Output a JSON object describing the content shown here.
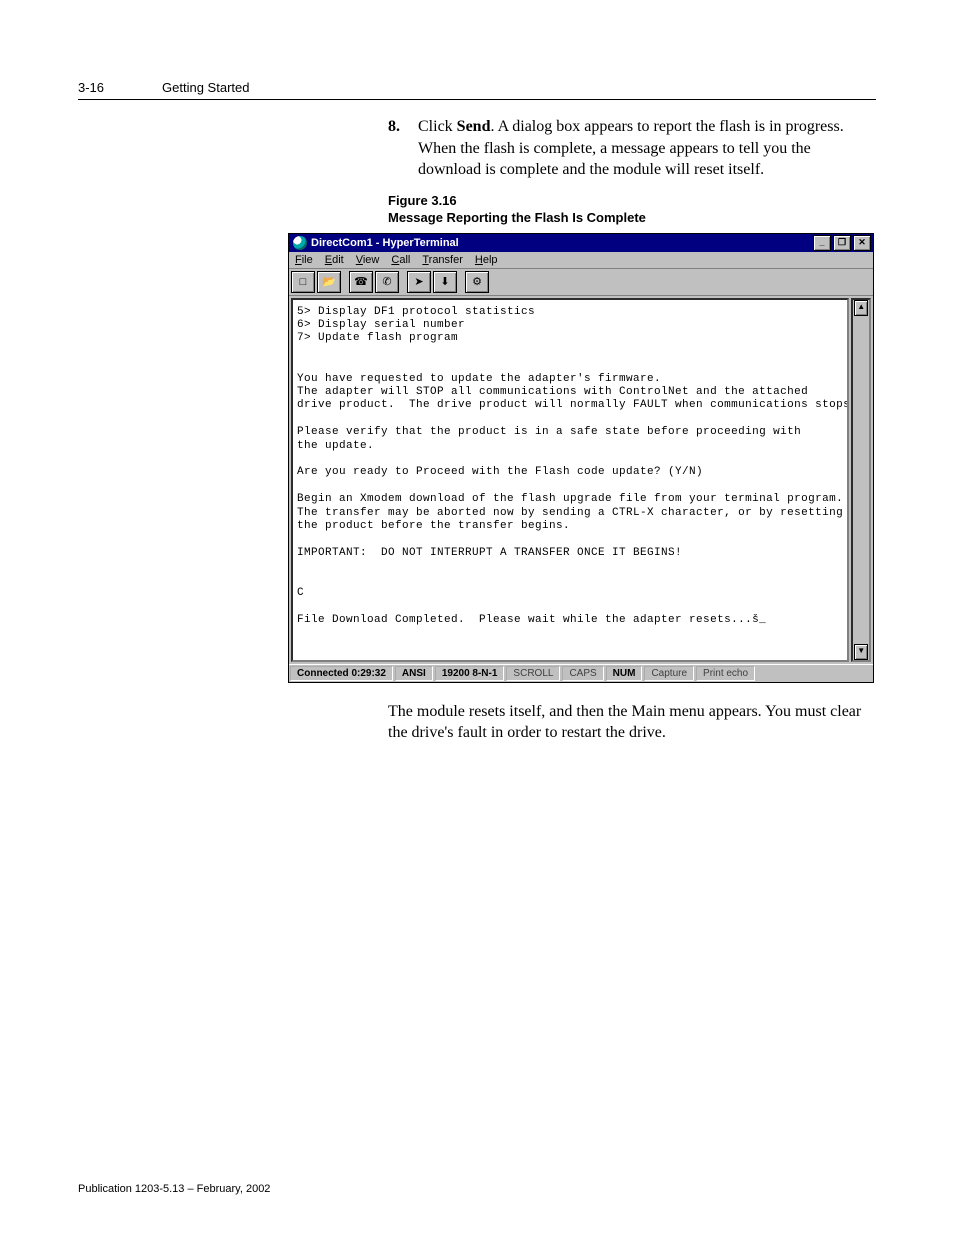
{
  "page": {
    "number": "3-16",
    "section": "Getting Started"
  },
  "step": {
    "num": "8.",
    "text_prefix": "Click ",
    "bold": "Send",
    "text_suffix": ". A dialog box appears to report the flash is in progress. When the flash is complete, a message appears to tell you the download is complete and the module will reset itself."
  },
  "figure": {
    "label": "Figure 3.16",
    "title": "Message Reporting the Flash Is Complete"
  },
  "hyperterminal": {
    "title": "DirectCom1 - HyperTerminal",
    "window_controls": {
      "min": "_",
      "max": "❐",
      "close": "✕"
    },
    "menu": {
      "file": {
        "u": "F",
        "rest": "ile"
      },
      "edit": {
        "u": "E",
        "rest": "dit"
      },
      "view": {
        "u": "V",
        "rest": "iew"
      },
      "call": {
        "u": "C",
        "rest": "all"
      },
      "transfer": {
        "u": "T",
        "rest": "ransfer"
      },
      "help": {
        "u": "H",
        "rest": "elp"
      }
    },
    "toolbar_icons": {
      "new": "□",
      "open": "📂",
      "connect": "☎",
      "disconnect": "✆",
      "send": "➤",
      "receive": "⬇",
      "properties": "⚙"
    },
    "scroll": {
      "up": "▲",
      "down": "▼"
    },
    "terminal_text": "5> Display DF1 protocol statistics\n6> Display serial number\n7> Update flash program\n\n\nYou have requested to update the adapter's firmware.\nThe adapter will STOP all communications with ControlNet and the attached\ndrive product.  The drive product will normally FAULT when communications stops.\n\nPlease verify that the product is in a safe state before proceeding with\nthe update.\n\nAre you ready to Proceed with the Flash code update? (Y/N)\n\nBegin an Xmodem download of the flash upgrade file from your terminal program.\nThe transfer may be aborted now by sending a CTRL-X character, or by resetting\nthe product before the transfer begins.\n\nIMPORTANT:  DO NOT INTERRUPT A TRANSFER ONCE IT BEGINS!\n\n\nC\n\nFile Download Completed.  Please wait while the adapter resets...š_",
    "status": {
      "conn": "Connected 0:29:32",
      "emul": "ANSI",
      "port": "19200 8-N-1",
      "scroll": "SCROLL",
      "caps": "CAPS",
      "num": "NUM",
      "capture": "Capture",
      "echo": "Print echo"
    }
  },
  "after_text": "The module resets itself, and then the Main menu appears. You must clear the drive's fault in order to restart the drive.",
  "footer": "Publication 1203-5.13 – February, 2002"
}
